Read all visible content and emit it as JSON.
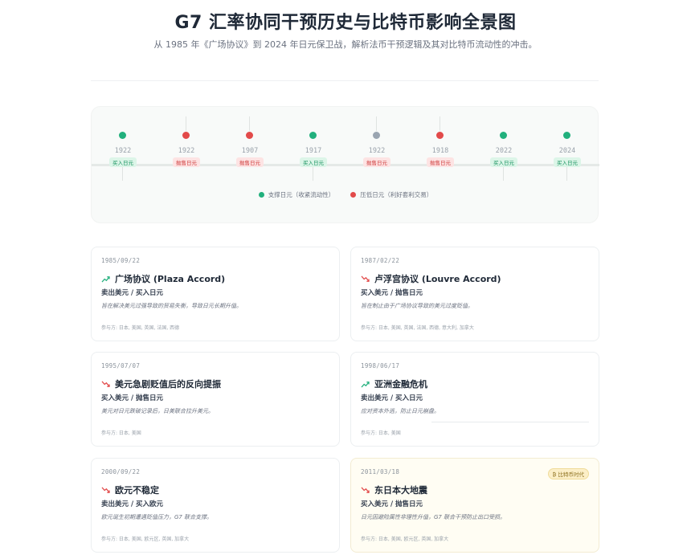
{
  "header": {
    "title": "G7 汇率协同干预历史与比特币影响全景图",
    "subtitle": "从 1985 年《广场协议》到 2024 年日元保卫战，解析法币干预逻辑及其对比特币流动性的冲击。"
  },
  "timeline": {
    "items": [
      {
        "year": "1922",
        "tag": "买入日元",
        "side": "buy",
        "dot": "green"
      },
      {
        "year": "1922",
        "tag": "抛售日元",
        "side": "sell",
        "dot": "red"
      },
      {
        "year": "1907",
        "tag": "抛售日元",
        "side": "sell",
        "dot": "red"
      },
      {
        "year": "1917",
        "tag": "买入日元",
        "side": "buy",
        "dot": "green"
      },
      {
        "year": "1922",
        "tag": "抛售日元",
        "side": "sell",
        "dot": "grey"
      },
      {
        "year": "1918",
        "tag": "抛售日元",
        "side": "sell",
        "dot": "red"
      },
      {
        "year": "2022",
        "tag": "买入日元",
        "side": "buy",
        "dot": "green"
      },
      {
        "year": "2024",
        "tag": "买入日元",
        "side": "buy",
        "dot": "green"
      }
    ],
    "legend": {
      "support": "支撑日元（收紧流动性）",
      "suppress": "压低日元（利好套利交易）"
    },
    "colors": {
      "green": "#22b07d",
      "red": "#e24a4a",
      "grey": "#9aa5b1"
    }
  },
  "cards": [
    {
      "date": "1985/09/22",
      "title": "广场协议 (Plaza Accord)",
      "trend": "up",
      "action": "卖出美元 / 买入日元",
      "desc": "旨在解决美元过强导致的贸易失衡，导致日元长期升值。",
      "parties": "参与方: 日本, 美国, 英国, 法国, 西德"
    },
    {
      "date": "1987/02/22",
      "title": "卢浮宫协议 (Louvre Accord)",
      "trend": "down",
      "action": "买入美元 / 抛售日元",
      "desc": "旨在制止由于广场协议导致的美元过度贬值。",
      "parties": "参与方: 日本, 美国, 英国, 法国, 西德, 意大利, 加拿大"
    },
    {
      "date": "1995/07/07",
      "title": "美元急剧贬值后的反向提振",
      "trend": "down",
      "action": "买入美元 / 抛售日元",
      "desc": "美元对日元跌破记录后，日美联合拉升美元。",
      "parties": "参与方: 日本, 美国"
    },
    {
      "date": "1998/06/17",
      "title": "亚洲金融危机",
      "trend": "up",
      "action": "卖出美元 / 买入日元",
      "desc": "应对资本外逃，防止日元崩盘。",
      "parties": "参与方: 日本, 美国"
    },
    {
      "date": "2000/09/22",
      "title": "欧元不稳定",
      "trend": "down",
      "action": "卖出美元 / 买入欧元",
      "desc": "欧元诞生初期遭遇贬值压力，G7 联合支撑。",
      "parties": "参与方: 日本, 美国, 欧元区, 英国, 加拿大"
    },
    {
      "date": "2011/03/18",
      "title": "东日本大地震",
      "trend": "down",
      "action": "买入美元 / 抛售日元",
      "desc": "日元因避险属性非理性升值，G7 联合干预防止出口受损。",
      "parties": "参与方: 日本, 美国, 欧元区, 英国, 加拿大",
      "badge": "₿ 比特币时代"
    }
  ]
}
